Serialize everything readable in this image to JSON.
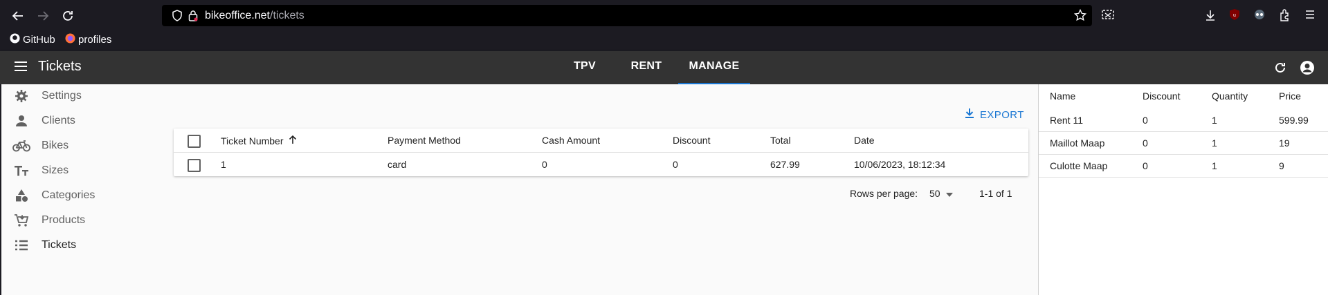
{
  "browser": {
    "url_host": "bikeoffice.net",
    "url_path": "/tickets",
    "bookmarks": [
      {
        "label": "GitHub",
        "icon": "github-icon"
      },
      {
        "label": "profiles",
        "icon": "firefox-icon"
      }
    ]
  },
  "appbar": {
    "title": "Tickets",
    "tabs": [
      {
        "label": "TPV",
        "active": false
      },
      {
        "label": "RENT",
        "active": false
      },
      {
        "label": "MANAGE",
        "active": true
      }
    ]
  },
  "sidebar": {
    "items": [
      {
        "label": "Settings",
        "icon": "gear-icon"
      },
      {
        "label": "Clients",
        "icon": "person-icon"
      },
      {
        "label": "Bikes",
        "icon": "bike-icon"
      },
      {
        "label": "Sizes",
        "icon": "text-size-icon"
      },
      {
        "label": "Categories",
        "icon": "category-icon"
      },
      {
        "label": "Products",
        "icon": "cart-icon"
      },
      {
        "label": "Tickets",
        "icon": "list-icon"
      }
    ]
  },
  "tickets": {
    "export_label": "EXPORT",
    "columns": [
      "Ticket Number",
      "Payment Method",
      "Cash Amount",
      "Discount",
      "Total",
      "Date"
    ],
    "rows": [
      {
        "number": "1",
        "payment": "card",
        "cash": "0",
        "discount": "0",
        "total": "627.99",
        "date": "10/06/2023, 18:12:34"
      }
    ],
    "rows_per_page_label": "Rows per page:",
    "rows_per_page": "50",
    "range": "1-1 of 1"
  },
  "detail": {
    "columns": [
      "Name",
      "Discount",
      "Quantity",
      "Price"
    ],
    "rows": [
      {
        "name": "Rent 11",
        "discount": "0",
        "quantity": "1",
        "price": "599.99"
      },
      {
        "name": "Maillot Maap",
        "discount": "0",
        "quantity": "1",
        "price": "19"
      },
      {
        "name": "Culotte Maap",
        "discount": "0",
        "quantity": "1",
        "price": "9"
      }
    ]
  },
  "colors": {
    "accent": "#1976d2",
    "appbar": "#333333",
    "chrome": "#1c1b22"
  }
}
